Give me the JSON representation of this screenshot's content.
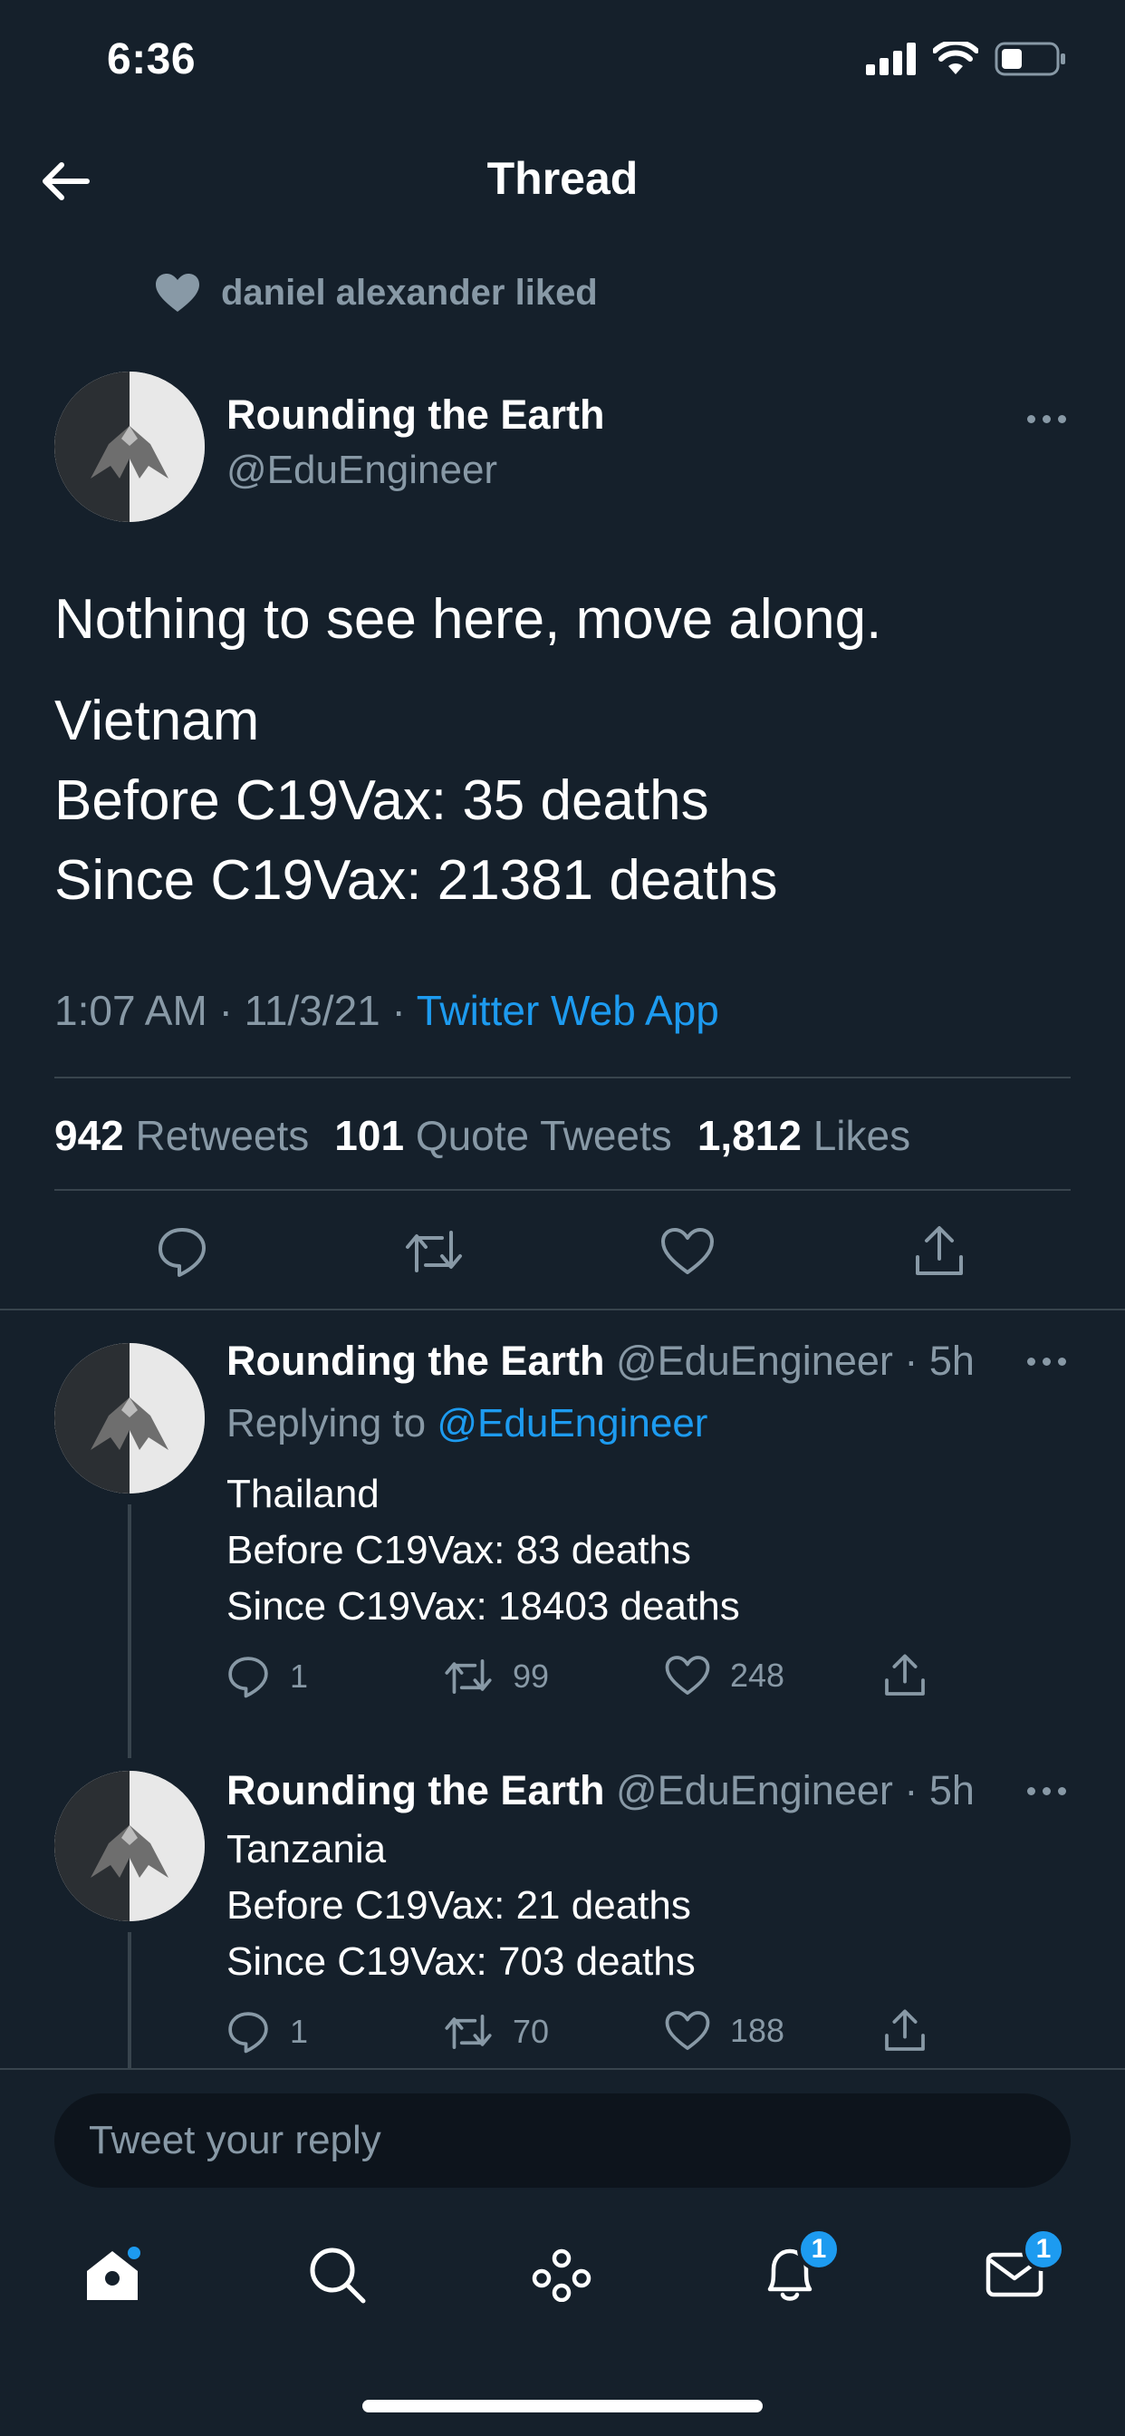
{
  "status_bar": {
    "time": "6:36"
  },
  "header": {
    "title": "Thread"
  },
  "social_context": {
    "text": "daniel alexander liked"
  },
  "main_tweet": {
    "author_name": "Rounding the Earth",
    "author_handle": "@EduEngineer",
    "line1": "Nothing to see here, move along.",
    "line2": "Vietnam",
    "line3": "Before C19Vax: 35 deaths",
    "line4": "Since C19Vax: 21381 deaths",
    "time": "1:07 AM",
    "date": "11/3/21",
    "source": "Twitter Web App",
    "retweets_count": "942",
    "retweets_label": "Retweets",
    "quotes_count": "101",
    "quotes_label": "Quote Tweets",
    "likes_count": "1,812",
    "likes_label": "Likes"
  },
  "replies": [
    {
      "author_name": "Rounding the Earth",
      "author_handle": "@EduEngineer",
      "age": "5h",
      "replying_label": "Replying to",
      "replying_to": "@EduEngineer",
      "line1": "Thailand",
      "line2": "Before C19Vax: 83 deaths",
      "line3": "Since C19Vax: 18403 deaths",
      "reply_count": "1",
      "retweet_count": "99",
      "like_count": "248"
    },
    {
      "author_name": "Rounding the Earth",
      "author_handle": "@EduEngineer",
      "age": "5h",
      "line1": "Tanzania",
      "line2": "Before C19Vax: 21 deaths",
      "line3": "Since C19Vax: 703 deaths",
      "reply_count": "1",
      "retweet_count": "70",
      "like_count": "188"
    }
  ],
  "composer": {
    "placeholder": "Tweet your reply"
  },
  "tabbar": {
    "notifications_badge": "1",
    "messages_badge": "1"
  },
  "colors": {
    "background": "#15202b",
    "accent": "#1d9bf0",
    "secondary_text": "#8899a6",
    "divider": "#38444d"
  },
  "icons": [
    "signal-icon",
    "wifi-icon",
    "battery-icon",
    "back-arrow-icon",
    "heart-icon",
    "more-icon",
    "reply-icon",
    "retweet-icon",
    "like-icon",
    "share-icon",
    "home-icon",
    "search-icon",
    "spaces-icon",
    "notifications-icon",
    "messages-icon"
  ]
}
